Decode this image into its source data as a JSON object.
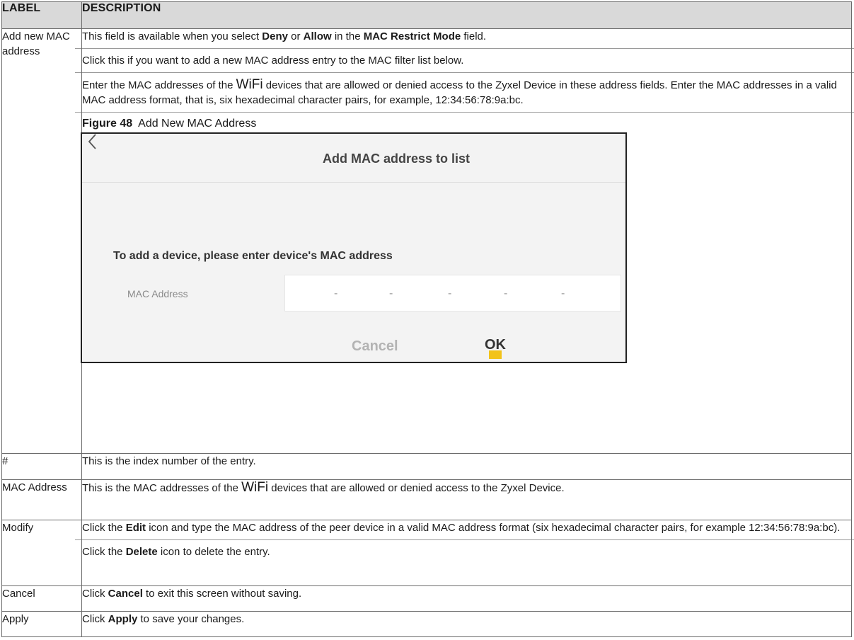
{
  "header": {
    "label": "LABEL",
    "description": "DESCRIPTION"
  },
  "add_row": {
    "label": "Add new MAC address",
    "p1": {
      "t1": "This field is available when you select ",
      "b1": "Deny",
      "t2": " or ",
      "b2": "Allow",
      "t3": " in the ",
      "b3": "MAC Restrict Mode",
      "t4": " field."
    },
    "p2": "Click this if you want to add a new MAC address entry to the MAC filter list below.",
    "p3": {
      "t1": "Enter the MAC addresses of the ",
      "wifi": "WiFi",
      "t2": " devices that are allowed or denied access to the Zyxel Device in these address fields. Enter the MAC addresses in a valid MAC address format, that is, six hexadecimal character pairs, for example, 12:34:56:78:9a:bc."
    },
    "figure_number": "Figure 48",
    "figure_title": "Add New MAC Address",
    "dialog": {
      "back_icon": "chevron-left-icon",
      "title": "Add MAC address to list",
      "prompt": "To add a device, please enter device's MAC address",
      "mac_label": "MAC Address",
      "separators": [
        "-",
        "-",
        "-",
        "-",
        "-"
      ],
      "cancel_label": "Cancel",
      "ok_label": "OK",
      "accent_color": "#f2c31a"
    }
  },
  "index_row": {
    "label": "#",
    "desc": "This is the index number of the entry."
  },
  "mac_row": {
    "label": "MAC Address",
    "t1": "This is the MAC addresses of the ",
    "wifi": "WiFi",
    "t2": " devices that are allowed or denied access to the Zyxel Device."
  },
  "modify_row": {
    "label": "Modify",
    "p1": {
      "t1": "Click the ",
      "b1": "Edit",
      "t2": " icon and type the MAC address of the peer device in a valid MAC address format (six hexadecimal character pairs, for example 12:34:56:78:9a:bc)."
    },
    "p2": {
      "t1": "Click the ",
      "b1": "Delete",
      "t2": " icon to delete the entry."
    }
  },
  "cancel_row": {
    "label": "Cancel",
    "t1": "Click ",
    "b1": "Cancel",
    "t2": " to exit this screen without saving."
  },
  "apply_row": {
    "label": "Apply",
    "t1": "Click ",
    "b1": "Apply",
    "t2": " to save your changes."
  }
}
